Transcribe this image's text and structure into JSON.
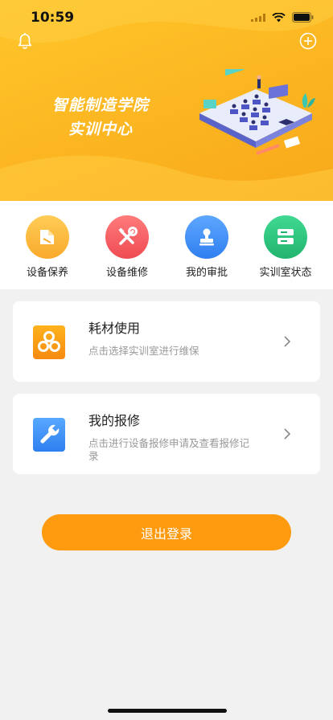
{
  "status_bar": {
    "time": "10:59"
  },
  "banner": {
    "title_line1": "智能制造学院",
    "title_line2": "实训中心",
    "background_color": "#fbb420"
  },
  "quick_actions": [
    {
      "label": "设备保养",
      "icon": "maintenance-icon",
      "color": "#fbb735"
    },
    {
      "label": "设备维修",
      "icon": "wrench-screwdriver-icon",
      "color": "#f25b5e"
    },
    {
      "label": "我的审批",
      "icon": "stamp-icon",
      "color": "#3c8ef5"
    },
    {
      "label": "实训室状态",
      "icon": "server-status-icon",
      "color": "#2ec27e"
    }
  ],
  "cards": [
    {
      "title": "耗材使用",
      "description": "点击选择实训室进行维保",
      "icon": "consumables-icon"
    },
    {
      "title": "我的报修",
      "description": "点击进行设备报修申请及查看报修记录",
      "icon": "wrench-icon"
    }
  ],
  "logout_label": "退出登录",
  "colors": {
    "accent": "#fd9a0e",
    "page_bg": "#f1f1f1"
  }
}
